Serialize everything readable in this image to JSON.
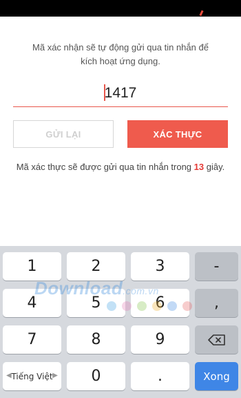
{
  "instructions": {
    "line1": "Mã xác nhận sẽ tự động gửi qua tin nhắn để",
    "line2": "kích hoạt ứng dụng."
  },
  "code_field": {
    "value": "1417"
  },
  "buttons": {
    "resend": "GỬI LẠI",
    "verify": "XÁC THỰC"
  },
  "countdown": {
    "prefix": "Mã xác thực sẽ được gửi qua tin nhắn trong",
    "seconds": "13",
    "suffix": "giây."
  },
  "keyboard": {
    "keys": [
      "1",
      "2",
      "3",
      "-",
      "4",
      "5",
      "6",
      ",",
      "7",
      "8",
      "9",
      "0",
      "."
    ],
    "language": "Tiếng Việt",
    "done": "Xong",
    "backspace_icon": "backspace-icon"
  },
  "watermark": {
    "brand": "Download",
    "domain": ".com.vn"
  },
  "colors": {
    "accent": "#ef5b4d",
    "done_key": "#3f86e6",
    "countdown_number": "#e53935"
  }
}
